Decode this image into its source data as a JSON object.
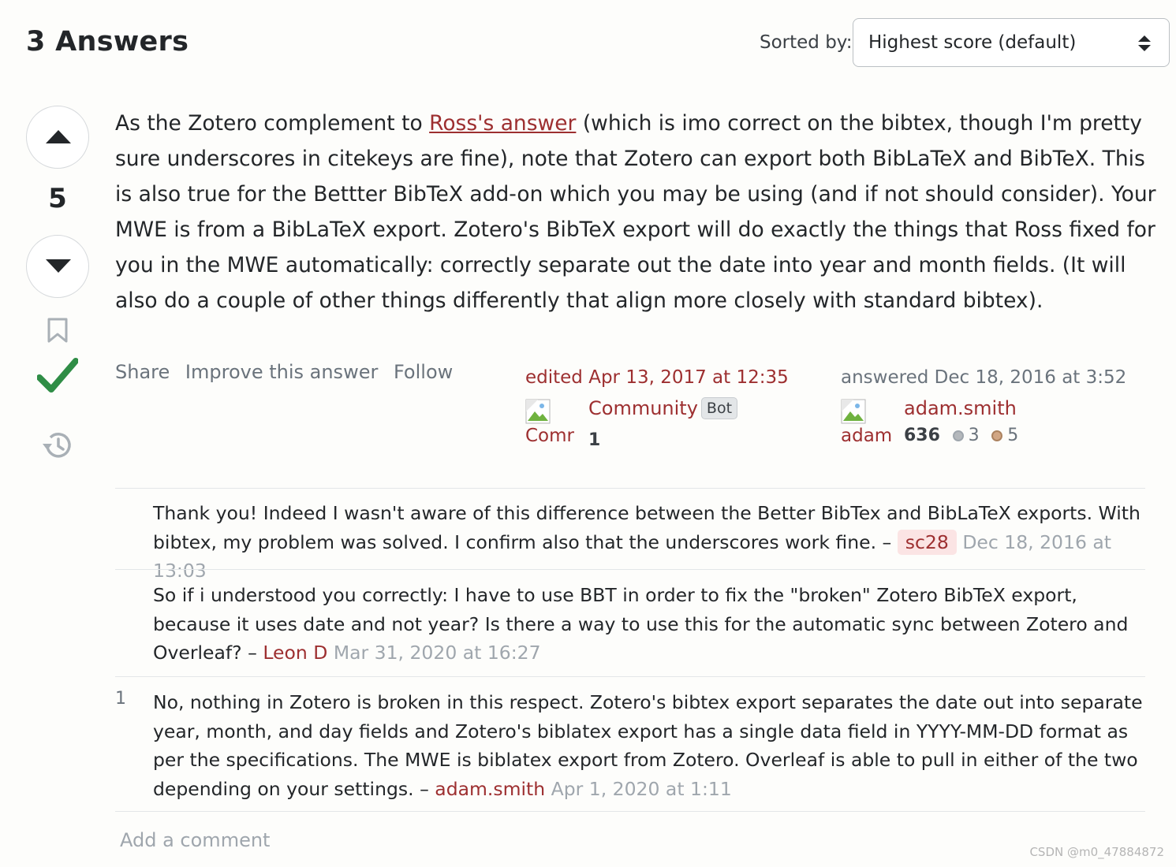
{
  "header": {
    "answers_count": "3 Answers",
    "sort_label": "Sorted by:",
    "sort_value": "Highest score (default)"
  },
  "vote": {
    "score": "5",
    "accepted": true
  },
  "answer": {
    "text_before_link": "As the Zotero complement to ",
    "link_text": "Ross's answer",
    "text_after_link": " (which is imo correct on the bibtex, though I'm pretty sure underscores in citekeys are fine), note that Zotero can export both BibLaTeX and BibTeX. This is also true for the Bettter BibTeX add-on which you may be using (and if not should consider). Your MWE is from a BibLaTeX export. Zotero's BibTeX export will do exactly the things that Ross fixed for you in the MWE automatically: correctly separate out the date into year and month fields. (It will also do a couple of other things differently that align more closely with standard bibtex)."
  },
  "post_menu": {
    "share": "Share",
    "improve": "Improve this answer",
    "follow": "Follow"
  },
  "edit_signature": {
    "action": "edited Apr 13, 2017 at 12:35",
    "avatar_alt": "Comr",
    "user_name": "Community",
    "bot_badge": "Bot",
    "reputation": "1"
  },
  "answer_signature": {
    "action_word": "answered",
    "action_date": " Dec 18, 2016 at 3:52",
    "avatar_alt": "adam",
    "user_name": "adam.smith",
    "reputation": "636",
    "silver_badges": "3",
    "bronze_badges": "5"
  },
  "comments": [
    {
      "score": "",
      "text": "Thank you! Indeed I wasn't aware of this difference between the Better BibTex and BibLaTeX exports. With bibtex, my problem was solved. I confirm also that the underscores work fine. – ",
      "user": "sc28",
      "date": "Dec 18, 2016 at 13:03"
    },
    {
      "score": "",
      "text": "So if i understood you correctly: I have to use BBT in order to fix the \"broken\" Zotero BibTeX export, because it uses date and not year? Is there a way to use this for the automatic sync between Zotero and Overleaf? – ",
      "user": "Leon D",
      "date": "Mar 31, 2020 at 16:27"
    },
    {
      "score": "1",
      "text": "No, nothing in Zotero is broken in this respect. Zotero's bibtex export separates the date out into separate year, month, and day fields and Zotero's biblatex export has a single data field in YYYY-MM-DD format as per the specifications. The MWE is biblatex export from Zotero. Overleaf is able to pull in either of the two depending on your settings. – ",
      "user": "adam.smith",
      "date": "Apr 1, 2020 at 1:11"
    }
  ],
  "add_comment": "Add a comment",
  "watermark": "CSDN @m0_47884872",
  "colors": {
    "link": "#9d2f30",
    "accepted": "#2f8d46",
    "muted": "#6a737c"
  }
}
